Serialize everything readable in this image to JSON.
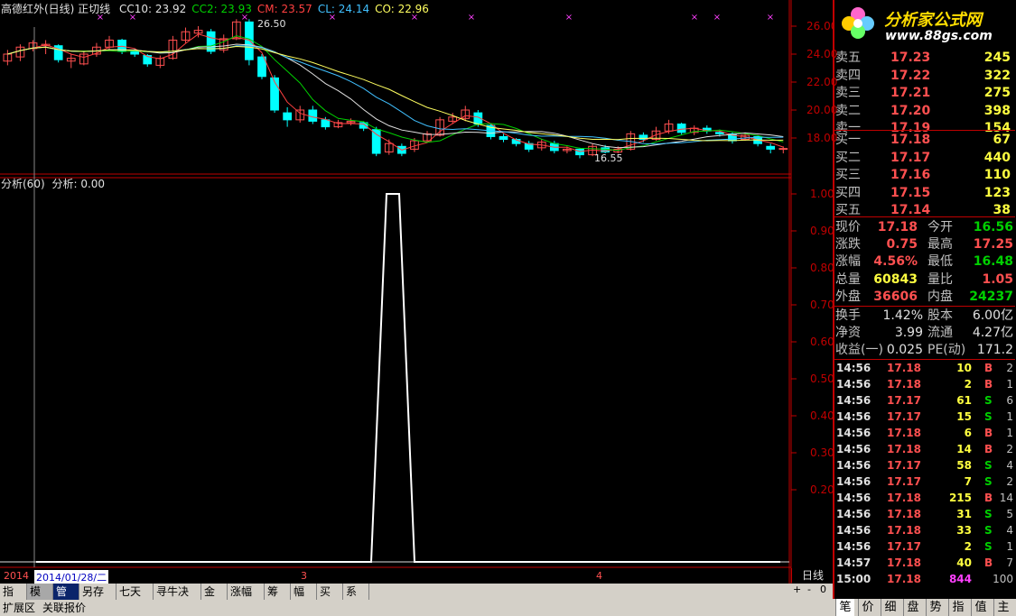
{
  "header": {
    "title": "高德红外(日线) 正切线",
    "indicators": [
      {
        "label": "CC10: 23.92",
        "color": "#e0e0e0"
      },
      {
        "label": "CC2: 23.93",
        "color": "#00d000"
      },
      {
        "label": "CM: 23.57",
        "color": "#ff4040"
      },
      {
        "label": "CL: 24.14",
        "color": "#40c0ff"
      },
      {
        "label": "CO: 22.96",
        "color": "#ffff60"
      }
    ]
  },
  "sub_header": {
    "title": "分析(60)",
    "value": "分析: 0.00"
  },
  "annotations": {
    "high": "26.50",
    "low": "16.55"
  },
  "price_axis": [
    "26.00",
    "24.00",
    "22.00",
    "20.00",
    "18.00"
  ],
  "sub_axis": [
    "1.00",
    "0.90",
    "0.80",
    "0.70",
    "0.60",
    "0.50",
    "0.40",
    "0.30",
    "0.20"
  ],
  "date_axis": {
    "current_date": "2014/01/28/二",
    "year_prefix": "2014",
    "months": [
      "3",
      "4"
    ]
  },
  "period_label": "日线",
  "zoom_buttons": [
    "+",
    "-",
    "0"
  ],
  "toolbar": [
    "指标",
    "模板",
    "管理",
    "另存为",
    "七天线",
    "寻牛决策",
    "金库",
    "涨幅量",
    "筹码",
    "幅度",
    "买点",
    "系统"
  ],
  "bottom_bar": [
    "扩展区",
    "关联报价"
  ],
  "logo": {
    "text": "分析家公式网",
    "url": "www.88gs.com"
  },
  "order_book": {
    "sell": [
      {
        "label": "卖五",
        "price": "17.23",
        "vol": "245"
      },
      {
        "label": "卖四",
        "price": "17.22",
        "vol": "322"
      },
      {
        "label": "卖三",
        "price": "17.21",
        "vol": "275"
      },
      {
        "label": "卖二",
        "price": "17.20",
        "vol": "398"
      },
      {
        "label": "卖一",
        "price": "17.19",
        "vol": "154"
      }
    ],
    "buy": [
      {
        "label": "买一",
        "price": "17.18",
        "vol": "67"
      },
      {
        "label": "买二",
        "price": "17.17",
        "vol": "440"
      },
      {
        "label": "买三",
        "price": "17.16",
        "vol": "110"
      },
      {
        "label": "买四",
        "price": "17.15",
        "vol": "123"
      },
      {
        "label": "买五",
        "price": "17.14",
        "vol": "38"
      }
    ]
  },
  "quote": [
    {
      "l1": "现价",
      "v1": "17.18",
      "c1": "#ff5050",
      "l2": "今开",
      "v2": "16.56",
      "c2": "#00d000"
    },
    {
      "l1": "涨跌",
      "v1": "0.75",
      "c1": "#ff5050",
      "l2": "最高",
      "v2": "17.25",
      "c2": "#ff5050"
    },
    {
      "l1": "涨幅",
      "v1": "4.56%",
      "c1": "#ff5050",
      "l2": "最低",
      "v2": "16.48",
      "c2": "#00d000"
    },
    {
      "l1": "总量",
      "v1": "60843",
      "c1": "#ffff40",
      "l2": "量比",
      "v2": "1.05",
      "c2": "#ff5050"
    },
    {
      "l1": "外盘",
      "v1": "36606",
      "c1": "#ff5050",
      "l2": "内盘",
      "v2": "24237",
      "c2": "#00d000"
    }
  ],
  "fundamentals": [
    {
      "l1": "换手",
      "v1": "1.42%",
      "l2": "股本",
      "v2": "6.00亿"
    },
    {
      "l1": "净资",
      "v1": "3.99",
      "l2": "流通",
      "v2": "4.27亿"
    },
    {
      "l1": "收益(一)",
      "v1": "0.025",
      "l2": "PE(动)",
      "v2": "171.2"
    }
  ],
  "ticks": [
    {
      "time": "14:56",
      "price": "17.18",
      "vol": "10",
      "side": "B",
      "n": "2"
    },
    {
      "time": "14:56",
      "price": "17.18",
      "vol": "2",
      "side": "B",
      "n": "1"
    },
    {
      "time": "14:56",
      "price": "17.17",
      "vol": "61",
      "side": "S",
      "n": "6"
    },
    {
      "time": "14:56",
      "price": "17.17",
      "vol": "15",
      "side": "S",
      "n": "1"
    },
    {
      "time": "14:56",
      "price": "17.18",
      "vol": "6",
      "side": "B",
      "n": "1"
    },
    {
      "time": "14:56",
      "price": "17.18",
      "vol": "14",
      "side": "B",
      "n": "2"
    },
    {
      "time": "14:56",
      "price": "17.17",
      "vol": "58",
      "side": "S",
      "n": "4"
    },
    {
      "time": "14:56",
      "price": "17.17",
      "vol": "7",
      "side": "S",
      "n": "2"
    },
    {
      "time": "14:56",
      "price": "17.18",
      "vol": "215",
      "side": "B",
      "n": "14"
    },
    {
      "time": "14:56",
      "price": "17.18",
      "vol": "31",
      "side": "S",
      "n": "5"
    },
    {
      "time": "14:56",
      "price": "17.18",
      "vol": "33",
      "side": "S",
      "n": "4"
    },
    {
      "time": "14:56",
      "price": "17.17",
      "vol": "2",
      "side": "S",
      "n": "1"
    },
    {
      "time": "14:57",
      "price": "17.18",
      "vol": "40",
      "side": "B",
      "n": "7"
    },
    {
      "time": "15:00",
      "price": "17.18",
      "vol": "844",
      "side": "",
      "n": "100"
    }
  ],
  "bottom_tabs": [
    "笔",
    "价",
    "细",
    "盘",
    "势",
    "指",
    "值",
    "主"
  ],
  "colors": {
    "up": "#ff5050",
    "down": "#00ffff",
    "frame": "#c00000",
    "label": "#c0c0c0"
  }
}
